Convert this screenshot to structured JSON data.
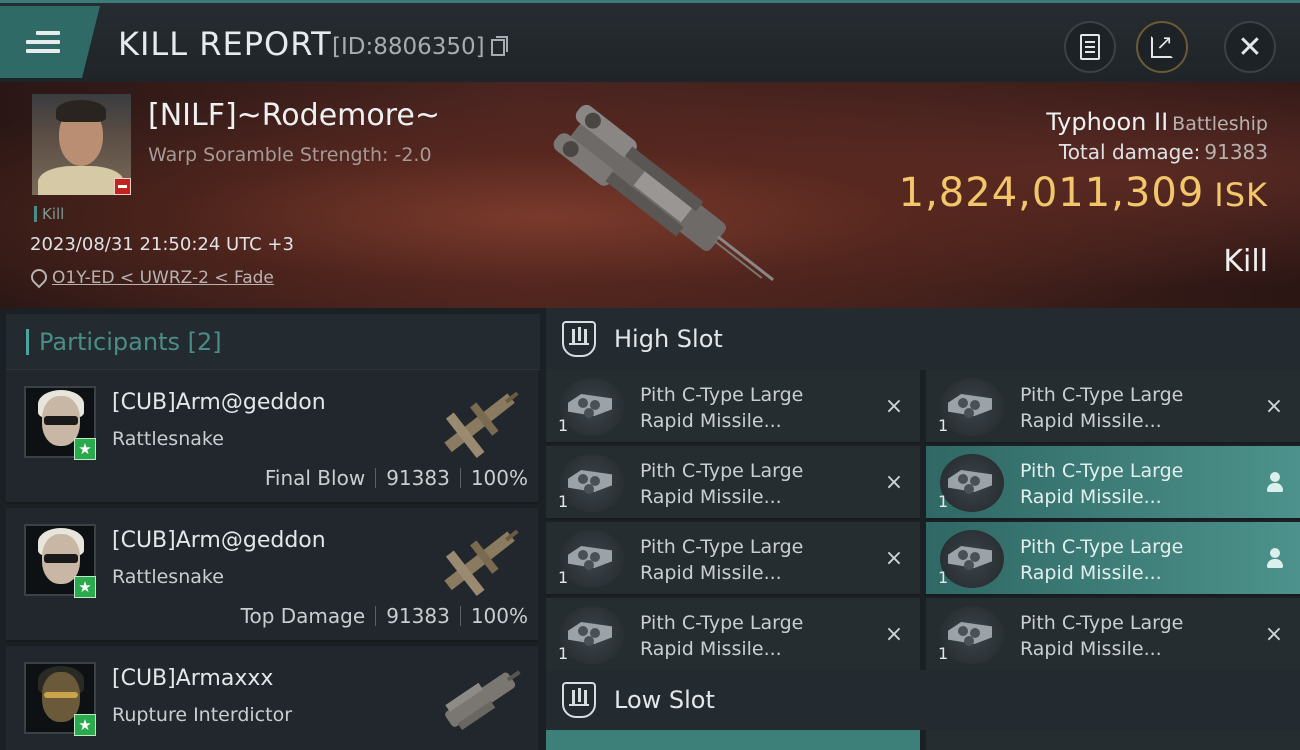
{
  "header": {
    "title": "KILL REPORT",
    "report_id": "[ID:8806350]"
  },
  "victim": {
    "name": "[NILF]~Rodemore~",
    "warp_scramble": "Warp Soramble Strength: -2.0",
    "tag": "Kill",
    "datetime": "2023/08/31 21:50:24 UTC +3",
    "location": "O1Y-ED < UWRZ-2 < Fade",
    "ship_name": "Typhoon II",
    "ship_class": "Battleship",
    "total_damage_label": "Total damage:",
    "total_damage_value": "91383",
    "isk_value": "1,824,011,309",
    "isk_unit": "ISK",
    "result": "Kill"
  },
  "participants": {
    "heading": "Participants",
    "count": "[2]",
    "rows": [
      {
        "name": "[CUB]Arm@geddon",
        "ship": "Rattlesnake",
        "role": "Final Blow",
        "damage": "91383",
        "percent": "100%"
      },
      {
        "name": "[CUB]Arm@geddon",
        "ship": "Rattlesnake",
        "role": "Top Damage",
        "damage": "91383",
        "percent": "100%"
      },
      {
        "name": "[CUB]Armaxxx",
        "ship": "Rupture Interdictor"
      }
    ]
  },
  "slots": {
    "high": {
      "label": "High Slot",
      "modules": [
        {
          "line1": "Pith C-Type Large",
          "line2": "Rapid Missile...",
          "qty": "1",
          "state": "destroyed"
        },
        {
          "line1": "Pith C-Type Large",
          "line2": "Rapid Missile...",
          "qty": "1",
          "state": "destroyed"
        },
        {
          "line1": "Pith C-Type Large",
          "line2": "Rapid Missile...",
          "qty": "1",
          "state": "destroyed"
        },
        {
          "line1": "Pith C-Type Large",
          "line2": "Rapid Missile...",
          "qty": "1",
          "state": "dropped"
        },
        {
          "line1": "Pith C-Type Large",
          "line2": "Rapid Missile...",
          "qty": "1",
          "state": "destroyed"
        },
        {
          "line1": "Pith C-Type Large",
          "line2": "Rapid Missile...",
          "qty": "1",
          "state": "dropped"
        },
        {
          "line1": "Pith C-Type Large",
          "line2": "Rapid Missile...",
          "qty": "1",
          "state": "destroyed"
        },
        {
          "line1": "Pith C-Type Large",
          "line2": "Rapid Missile...",
          "qty": "1",
          "state": "destroyed"
        }
      ]
    },
    "low": {
      "label": "Low Slot"
    }
  },
  "colors": {
    "accent": "#4a8d86",
    "isk": "#f2c66a",
    "badge_green": "#2aa94d",
    "badge_red": "#c3231d"
  },
  "icons": {
    "destroyed": "×",
    "star": "★"
  }
}
